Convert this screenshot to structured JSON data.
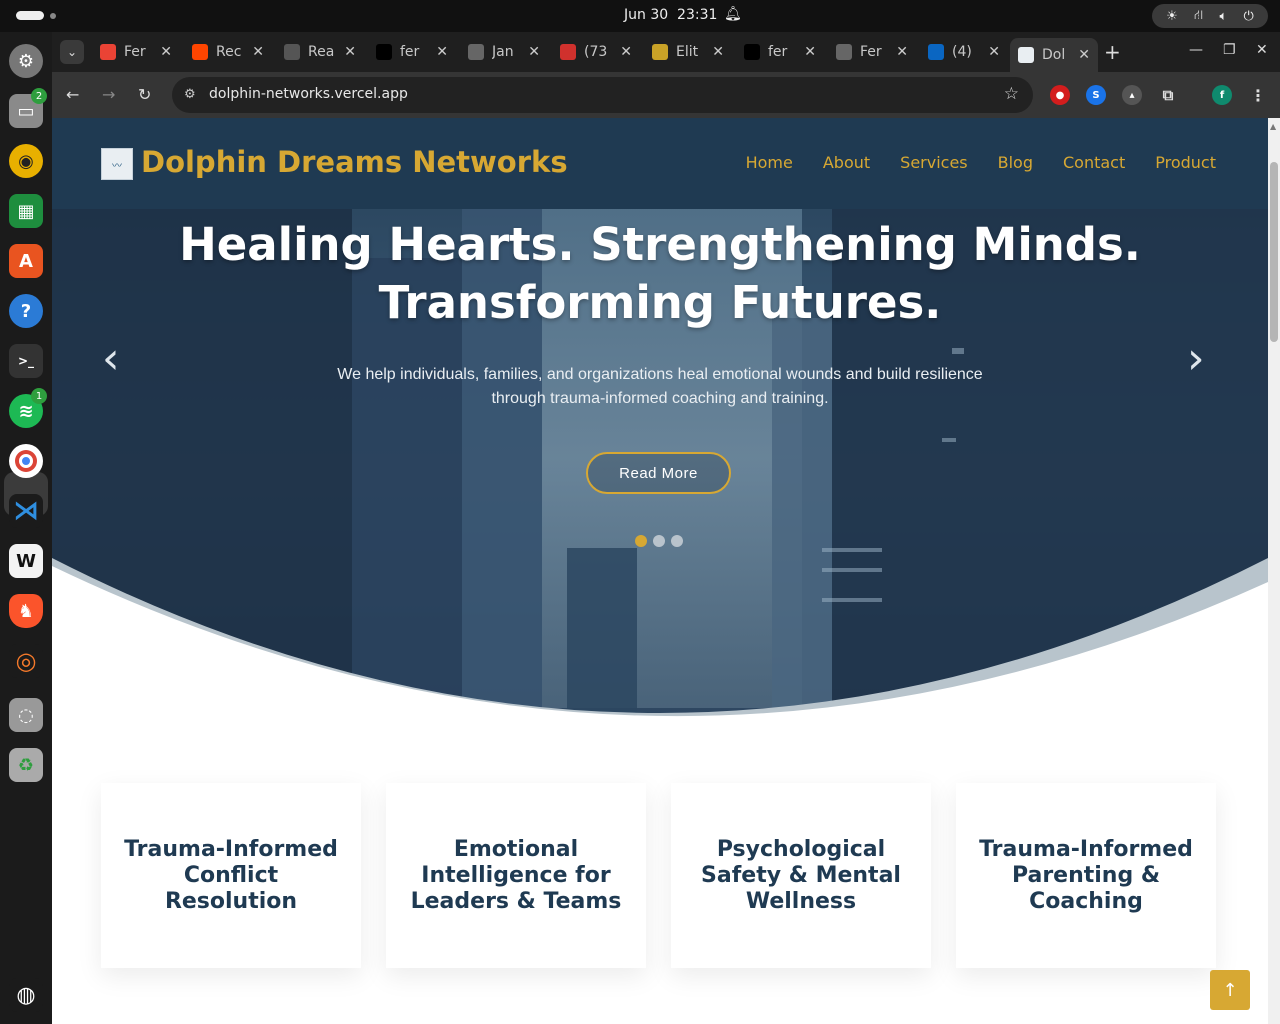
{
  "system": {
    "date": "Jun 30",
    "time": "23:31"
  },
  "dock": {
    "files_badge": "2",
    "spotify_badge": "1"
  },
  "tabs": [
    {
      "label": "Fer",
      "icon": "gmail-icon",
      "color": "#ea4335"
    },
    {
      "label": "Rec",
      "icon": "reddit-icon",
      "color": "#ff4500"
    },
    {
      "label": "Rea",
      "icon": "openai-icon",
      "color": "#555555"
    },
    {
      "label": "fer",
      "icon": "github-icon",
      "color": "#000000"
    },
    {
      "label": "Jan",
      "icon": "page-icon",
      "color": "#666666"
    },
    {
      "label": "(73",
      "icon": "badge-73-icon",
      "color": "#d0312d"
    },
    {
      "label": "Elit",
      "icon": "ticket-icon",
      "color": "#c9a227"
    },
    {
      "label": "fer",
      "icon": "github-icon",
      "color": "#000000"
    },
    {
      "label": "Fer",
      "icon": "page-icon",
      "color": "#666666"
    },
    {
      "label": "(4)",
      "icon": "linkedin-icon",
      "color": "#0a66c2"
    },
    {
      "label": "Dol",
      "icon": "dolphin-icon",
      "color": "#e9eef2"
    }
  ],
  "address": {
    "url": "dolphin-networks.vercel.app"
  },
  "profile_initial": "f",
  "site": {
    "brand": "Dolphin Dreams Networks",
    "nav": [
      "Home",
      "About",
      "Services",
      "Blog",
      "Contact",
      "Product"
    ],
    "hero": {
      "headline_line1": "Healing Hearts. Strengthening Minds.",
      "headline_line2": "Transforming Futures.",
      "subtext": "We help individuals, families, and organizations heal emotional wounds and build resilience through trauma-informed coaching and training.",
      "cta": "Read More",
      "active_slide": 1,
      "slide_count": 3
    },
    "services": [
      "Trauma-Informed Conflict Resolution",
      "Emotional Intelligence for Leaders & Teams",
      "Psychological Safety & Mental Wellness",
      "Trauma-Informed Parenting & Coaching"
    ]
  },
  "colors": {
    "brand_gold": "#d7a833",
    "navy": "#1f3a52"
  }
}
